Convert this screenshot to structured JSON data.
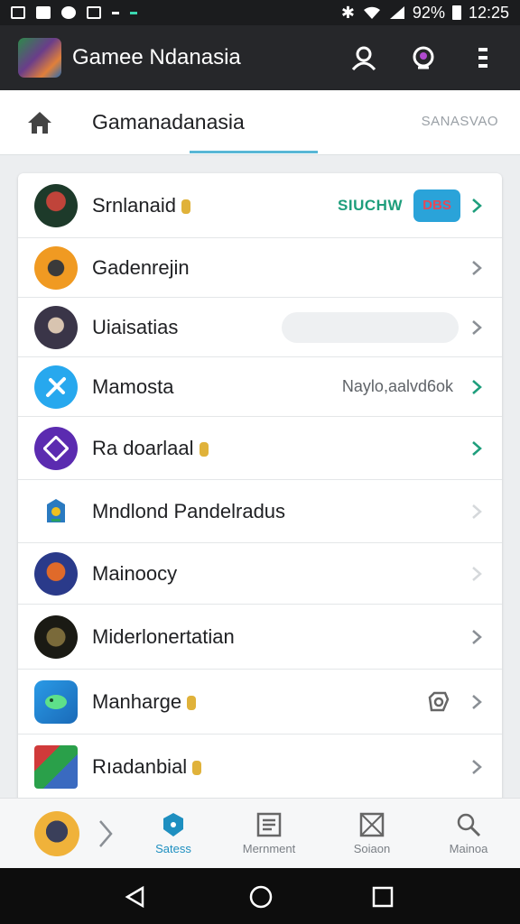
{
  "status_bar": {
    "battery": "92%",
    "time": "12:25"
  },
  "app_bar": {
    "title": "Gamee Ndanasia",
    "icons": [
      "app-logo",
      "profile-icon",
      "notification-icon",
      "more-vert-icon"
    ]
  },
  "tabs": {
    "title": "Gamanadanasia",
    "secondary": "SANASVAO",
    "home_icon": "home-icon"
  },
  "list": {
    "items": [
      {
        "label": "Srnlanaid",
        "verified": true,
        "status": "SIUCHW",
        "badge": "DBS"
      },
      {
        "label": "Gadenrejin",
        "verified": false
      },
      {
        "label": "Uiaisatias",
        "verified": false,
        "bar": true
      },
      {
        "label": "Mamosta",
        "verified": false,
        "meta": "Naylo,aalvd6ok"
      },
      {
        "label": "Ra doarlaal",
        "verified": true
      },
      {
        "label": "Mndlond Pandelradus",
        "verified": false
      },
      {
        "label": "Mainoocy",
        "verified": false
      },
      {
        "label": "Miderlonertatian",
        "verified": false
      },
      {
        "label": "Manharge",
        "verified": true,
        "extra_icon": "camera-icon"
      },
      {
        "label": "Rıadanbial",
        "verified": true
      }
    ]
  },
  "bottom_nav": {
    "items": [
      {
        "label": "Satess",
        "icon": "shield-icon",
        "active": true
      },
      {
        "label": "Mernment",
        "icon": "newspaper-icon",
        "active": false
      },
      {
        "label": "Soiaon",
        "icon": "image-icon",
        "active": false
      },
      {
        "label": "Mainoa",
        "icon": "search-icon",
        "active": false
      }
    ]
  },
  "colors": {
    "accent": "#1e8fc0",
    "status_green": "#1e9e7c",
    "tab_indicator": "#58b7d6",
    "app_bar": "#26272a"
  }
}
